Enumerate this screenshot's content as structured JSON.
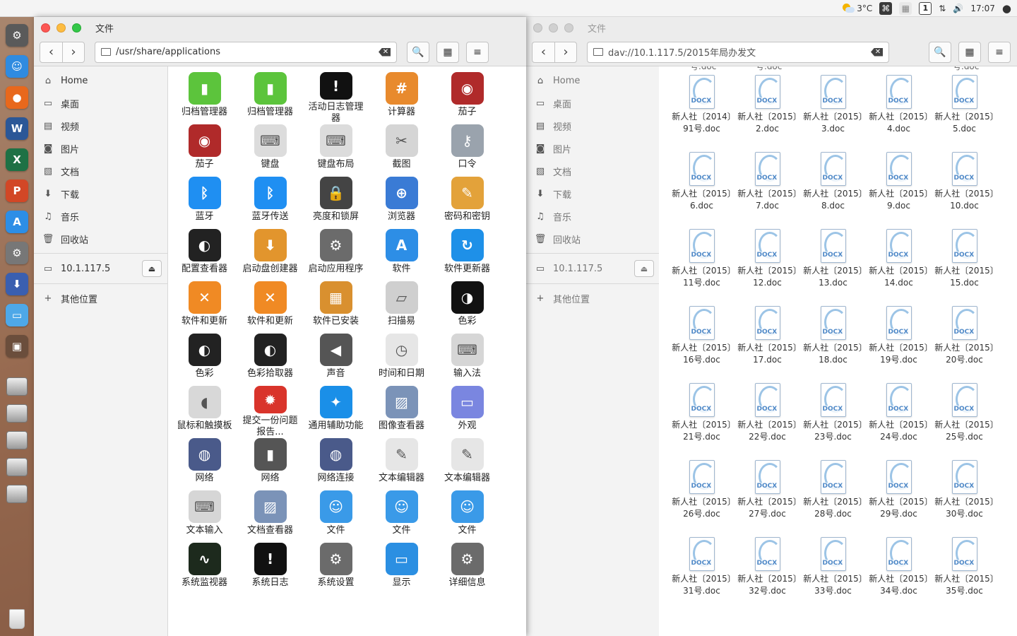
{
  "topbar": {
    "weather": "3°C",
    "time": "17:07"
  },
  "dock": {
    "apps": [
      {
        "name": "dock-settings-icon",
        "color": "#5a5a5a",
        "glyph": "⚙"
      },
      {
        "name": "dock-finder-icon",
        "color": "#2f8be0",
        "glyph": "☺"
      },
      {
        "name": "dock-firefox-icon",
        "color": "#e8681c",
        "glyph": "●"
      },
      {
        "name": "dock-word-icon",
        "color": "#2b5797",
        "glyph": "W"
      },
      {
        "name": "dock-excel-icon",
        "color": "#1e7145",
        "glyph": "X"
      },
      {
        "name": "dock-powerpoint-icon",
        "color": "#d24726",
        "glyph": "P"
      },
      {
        "name": "dock-appstore-icon",
        "color": "#2d8ee6",
        "glyph": "A"
      },
      {
        "name": "dock-system-settings-icon",
        "color": "#777777",
        "glyph": "⚙"
      },
      {
        "name": "dock-installer-icon",
        "color": "#3a5fb0",
        "glyph": "⬇"
      },
      {
        "name": "dock-folder-icon",
        "color": "#4ea8e8",
        "glyph": "▭"
      },
      {
        "name": "dock-window-icon",
        "color": "#6b4e3c",
        "glyph": "▣"
      }
    ],
    "disks": 5
  },
  "left_window": {
    "title": "文件",
    "path": "/usr/share/applications",
    "sidebar": {
      "places": [
        {
          "label": "Home",
          "icon": "⌂"
        },
        {
          "label": "桌面",
          "icon": "▭"
        },
        {
          "label": "视频",
          "icon": "▤"
        },
        {
          "label": "图片",
          "icon": "◙"
        },
        {
          "label": "文档",
          "icon": "▧"
        },
        {
          "label": "下载",
          "icon": "⬇"
        },
        {
          "label": "音乐",
          "icon": "♫"
        },
        {
          "label": "回收站",
          "icon": "🗑"
        }
      ],
      "network": "10.1.117.5",
      "other": "其他位置"
    },
    "apps": [
      {
        "label": "归档管理器",
        "bg": "#5cc43c",
        "glyph": "▮"
      },
      {
        "label": "归档管理器",
        "bg": "#5cc43c",
        "glyph": "▮"
      },
      {
        "label": "活动日志管理器",
        "bg": "#111111",
        "glyph": "!"
      },
      {
        "label": "计算器",
        "bg": "#e88a2d",
        "glyph": "#"
      },
      {
        "label": "茄子",
        "bg": "#b02a2a",
        "glyph": "◉"
      },
      {
        "label": "茄子",
        "bg": "#b02a2a",
        "glyph": "◉"
      },
      {
        "label": "键盘",
        "bg": "#dcdcdc",
        "glyph": "⌨"
      },
      {
        "label": "键盘布局",
        "bg": "#dcdcdc",
        "glyph": "⌨"
      },
      {
        "label": "截图",
        "bg": "#d5d5d5",
        "glyph": "✂"
      },
      {
        "label": "口令",
        "bg": "#9aa3ad",
        "glyph": "⚷"
      },
      {
        "label": "蓝牙",
        "bg": "#1f8ff2",
        "glyph": "ᛒ"
      },
      {
        "label": "蓝牙传送",
        "bg": "#1f8ff2",
        "glyph": "ᛒ"
      },
      {
        "label": "亮度和锁屏",
        "bg": "#444444",
        "glyph": "🔒"
      },
      {
        "label": "浏览器",
        "bg": "#3a7bd5",
        "glyph": "⊕"
      },
      {
        "label": "密码和密钥",
        "bg": "#e3a23a",
        "glyph": "✎"
      },
      {
        "label": "配置查看器",
        "bg": "#222222",
        "glyph": "◐"
      },
      {
        "label": "启动盘创建器",
        "bg": "#e2952d",
        "glyph": "⬇"
      },
      {
        "label": "启动应用程序",
        "bg": "#6b6b6b",
        "glyph": "⚙"
      },
      {
        "label": "软件",
        "bg": "#2d8ee6",
        "glyph": "A"
      },
      {
        "label": "软件更新器",
        "bg": "#1e90e8",
        "glyph": "↻"
      },
      {
        "label": "软件和更新",
        "bg": "#f08a24",
        "glyph": "✕"
      },
      {
        "label": "软件和更新",
        "bg": "#f08a24",
        "glyph": "✕"
      },
      {
        "label": "软件已安装",
        "bg": "#d9902f",
        "glyph": "▦"
      },
      {
        "label": "扫描易",
        "bg": "#cfcfcf",
        "glyph": "▱"
      },
      {
        "label": "色彩",
        "bg": "#111111",
        "glyph": "◑"
      },
      {
        "label": "色彩",
        "bg": "#222222",
        "glyph": "◐"
      },
      {
        "label": "色彩拾取器",
        "bg": "#222222",
        "glyph": "◐"
      },
      {
        "label": "声音",
        "bg": "#555555",
        "glyph": "◀"
      },
      {
        "label": "时间和日期",
        "bg": "#e6e6e6",
        "glyph": "◷"
      },
      {
        "label": "输入法",
        "bg": "#d6d6d6",
        "glyph": "⌨"
      },
      {
        "label": "鼠标和触摸板",
        "bg": "#d8d8d8",
        "glyph": "◖"
      },
      {
        "label": "提交一份问题报告...",
        "bg": "#d9342b",
        "glyph": "✹"
      },
      {
        "label": "通用辅助功能",
        "bg": "#1a8fe8",
        "glyph": "✦"
      },
      {
        "label": "图像查看器",
        "bg": "#7b93b8",
        "glyph": "▨"
      },
      {
        "label": "外观",
        "bg": "#7a86e0",
        "glyph": "▭"
      },
      {
        "label": "网络",
        "bg": "#4a5a8a",
        "glyph": "◍"
      },
      {
        "label": "网络",
        "bg": "#555555",
        "glyph": "▮"
      },
      {
        "label": "网络连接",
        "bg": "#4a5a8a",
        "glyph": "◍"
      },
      {
        "label": "文本编辑器",
        "bg": "#e6e6e6",
        "glyph": "✎"
      },
      {
        "label": "文本编辑器",
        "bg": "#e6e6e6",
        "glyph": "✎"
      },
      {
        "label": "文本输入",
        "bg": "#d6d6d6",
        "glyph": "⌨"
      },
      {
        "label": "文档查看器",
        "bg": "#7b93b8",
        "glyph": "▨"
      },
      {
        "label": "文件",
        "bg": "#3a9ae8",
        "glyph": "☺"
      },
      {
        "label": "文件",
        "bg": "#3a9ae8",
        "glyph": "☺"
      },
      {
        "label": "文件",
        "bg": "#3a9ae8",
        "glyph": "☺"
      },
      {
        "label": "系统监视器",
        "bg": "#1d2a1d",
        "glyph": "∿"
      },
      {
        "label": "系统日志",
        "bg": "#111111",
        "glyph": "!"
      },
      {
        "label": "系统设置",
        "bg": "#6b6b6b",
        "glyph": "⚙"
      },
      {
        "label": "显示",
        "bg": "#2b8fe2",
        "glyph": "▭"
      },
      {
        "label": "详细信息",
        "bg": "#6b6b6b",
        "glyph": "⚙"
      }
    ]
  },
  "right_window": {
    "title": "文件",
    "path": "dav://10.1.117.5/2015年局办发文",
    "sidebar": {
      "places": [
        {
          "label": "Home",
          "icon": "⌂"
        },
        {
          "label": "桌面",
          "icon": "▭"
        },
        {
          "label": "视频",
          "icon": "▤"
        },
        {
          "label": "图片",
          "icon": "◙"
        },
        {
          "label": "文档",
          "icon": "▧"
        },
        {
          "label": "下载",
          "icon": "⬇"
        },
        {
          "label": "音乐",
          "icon": "♫"
        },
        {
          "label": "回收站",
          "icon": "🗑"
        }
      ],
      "network": "10.1.117.5",
      "other": "其他位置"
    },
    "peek_label": "号.doc",
    "doc_badge": "DOCX",
    "files": [
      "新人社〔2014〕91号.doc",
      "新人社〔2015〕2.doc",
      "新人社〔2015〕3.doc",
      "新人社〔2015〕4.doc",
      "新人社〔2015〕5.doc",
      "新人社〔2015〕6.doc",
      "新人社〔2015〕7.doc",
      "新人社〔2015〕8.doc",
      "新人社〔2015〕9.doc",
      "新人社〔2015〕10.doc",
      "新人社〔2015〕11号.doc",
      "新人社〔2015〕12.doc",
      "新人社〔2015〕13.doc",
      "新人社〔2015〕14.doc",
      "新人社〔2015〕15.doc",
      "新人社〔2015〕16号.doc",
      "新人社〔2015〕17.doc",
      "新人社〔2015〕18.doc",
      "新人社〔2015〕19号.doc",
      "新人社〔2015〕20号.doc",
      "新人社〔2015〕21号.doc",
      "新人社〔2015〕22号.doc",
      "新人社〔2015〕23号.doc",
      "新人社〔2015〕24号.doc",
      "新人社〔2015〕25号.doc",
      "新人社〔2015〕26号.doc",
      "新人社〔2015〕27号.doc",
      "新人社〔2015〕28号.doc",
      "新人社〔2015〕29号.doc",
      "新人社〔2015〕30号.doc",
      "新人社〔2015〕31号.doc",
      "新人社〔2015〕32号.doc",
      "新人社〔2015〕33号.doc",
      "新人社〔2015〕34号.doc",
      "新人社〔2015〕35号.doc"
    ]
  }
}
